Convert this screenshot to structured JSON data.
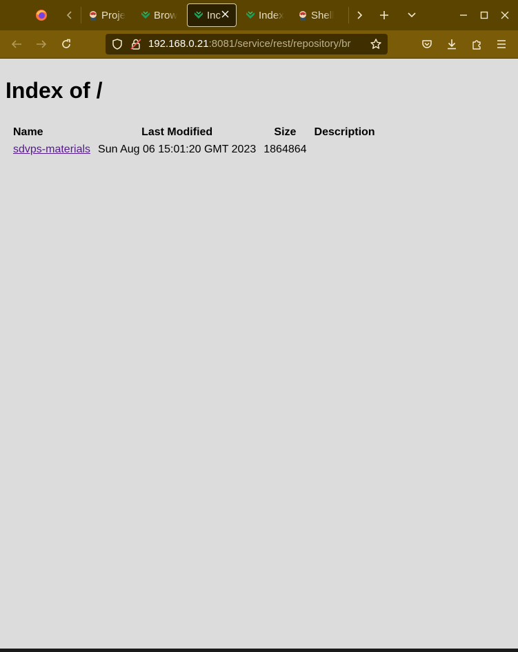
{
  "browser": {
    "tabs": [
      {
        "label": "Proje",
        "icon": "jenkins-icon",
        "active": false
      },
      {
        "label": "Brow",
        "icon": "nexus-icon",
        "active": false
      },
      {
        "label": "Inc",
        "icon": "nexus-icon",
        "active": true
      },
      {
        "label": "Index",
        "icon": "nexus-icon",
        "active": false
      },
      {
        "label": "Shell",
        "icon": "jenkins-icon",
        "active": false
      }
    ],
    "url_host": "192.168.0.21",
    "url_rest": ":8081/service/rest/repository/br",
    "colors": {
      "tabbar": "#5b4400",
      "navbar": "#7a5b08",
      "urlbar": "#3f2f00",
      "page": "#dcdcdc",
      "link": "#551a8b"
    }
  },
  "page": {
    "title": "Index of /",
    "columns": {
      "name": "Name",
      "modified": "Last Modified",
      "size": "Size",
      "description": "Description"
    },
    "rows": [
      {
        "name": "sdvps-materials",
        "modified": "Sun Aug 06 15:01:20 GMT 2023",
        "size": "1864864",
        "description": ""
      }
    ]
  }
}
